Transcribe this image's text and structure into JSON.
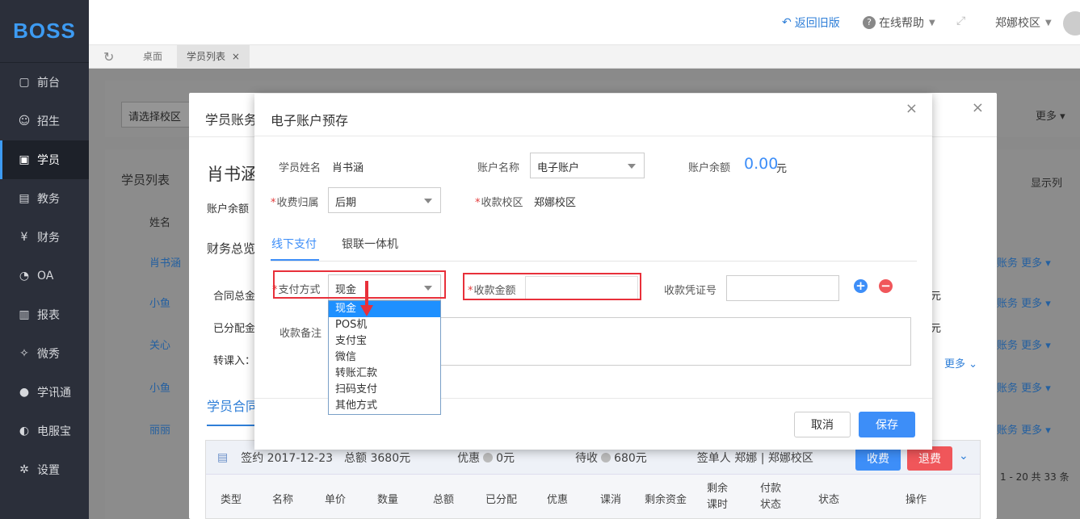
{
  "app": {
    "logo": "BOSS"
  },
  "sidebar": {
    "items": [
      {
        "label": "前台",
        "icon": "calendar-icon"
      },
      {
        "label": "招生",
        "icon": "user-add-icon"
      },
      {
        "label": "学员",
        "icon": "id-card-icon",
        "active": true
      },
      {
        "label": "教务",
        "icon": "book-icon"
      },
      {
        "label": "财务",
        "icon": "yen-icon"
      },
      {
        "label": "OA",
        "icon": "chat-icon"
      },
      {
        "label": "报表",
        "icon": "bar-chart-icon"
      },
      {
        "label": "微秀",
        "icon": "show-icon"
      },
      {
        "label": "学讯通",
        "icon": "location-icon"
      },
      {
        "label": "电服宝",
        "icon": "phone-icon"
      },
      {
        "label": "设置",
        "icon": "gear-icon"
      }
    ]
  },
  "topbar": {
    "back_old": "返回旧版",
    "help": "在线帮助",
    "campus": "郑娜校区"
  },
  "tabs": {
    "home": "桌面",
    "student_list": "学员列表"
  },
  "background": {
    "campus_select": "请选择校区",
    "list_title": "学员列表",
    "col_name": "姓名",
    "more": "更多",
    "display_col": "显示列",
    "names": [
      "肖书涵",
      "小鱼",
      "关心",
      "小鱼",
      "丽丽"
    ],
    "finance": "账务",
    "pagination": "1 - 20  共 33 条"
  },
  "modal_bg": {
    "title": "学员账务",
    "student_name": "肖书涵",
    "account_balance_label": "账户余额",
    "finance_overview": "财务总览",
    "contract_total": "合同总金",
    "allocated": "已分配金",
    "transfer_in": "转课入：",
    "more": "更多",
    "contract_tab": "学员合同",
    "contract": {
      "date": "签约 2017-12-23",
      "total": "总额 3680元",
      "discount_label": "优惠",
      "discount_value": "0元",
      "pending_label": "待收",
      "pending_value": "680元",
      "signer": "签单人 郑娜 | 郑娜校区",
      "collect_btn": "收费",
      "refund_btn": "退费"
    },
    "columns": [
      "类型",
      "名称",
      "单价",
      "数量",
      "总额",
      "已分配",
      "优惠",
      "课消",
      "剩余资金",
      "剩余课时",
      "付款状态",
      "状态",
      "操作"
    ],
    "yuan": "元"
  },
  "modal": {
    "title": "电子账户预存",
    "student_name_label": "学员姓名",
    "student_name": "肖书涵",
    "account_name_label": "账户名称",
    "account_name": "电子账户",
    "balance_label": "账户余额",
    "balance": "0.00",
    "balance_unit": "元",
    "fee_owner_label": "收费归属",
    "fee_owner": "后期",
    "collect_campus_label": "收款校区",
    "collect_campus": "郑娜校区",
    "tab_offline": "线下支付",
    "tab_unionpay": "银联一体机",
    "pay_method_label": "支付方式",
    "pay_method": "现金",
    "amount_label": "收款金额",
    "voucher_label": "收款凭证号",
    "remark_label": "收款备注",
    "cancel": "取消",
    "save": "保存",
    "options": [
      "现金",
      "POS机",
      "支付宝",
      "微信",
      "转账汇款",
      "扫码支付",
      "其他方式"
    ]
  },
  "colors": {
    "accent": "#3d9bf2",
    "danger": "#e8303a",
    "sidebar": "#2b2f3a"
  }
}
